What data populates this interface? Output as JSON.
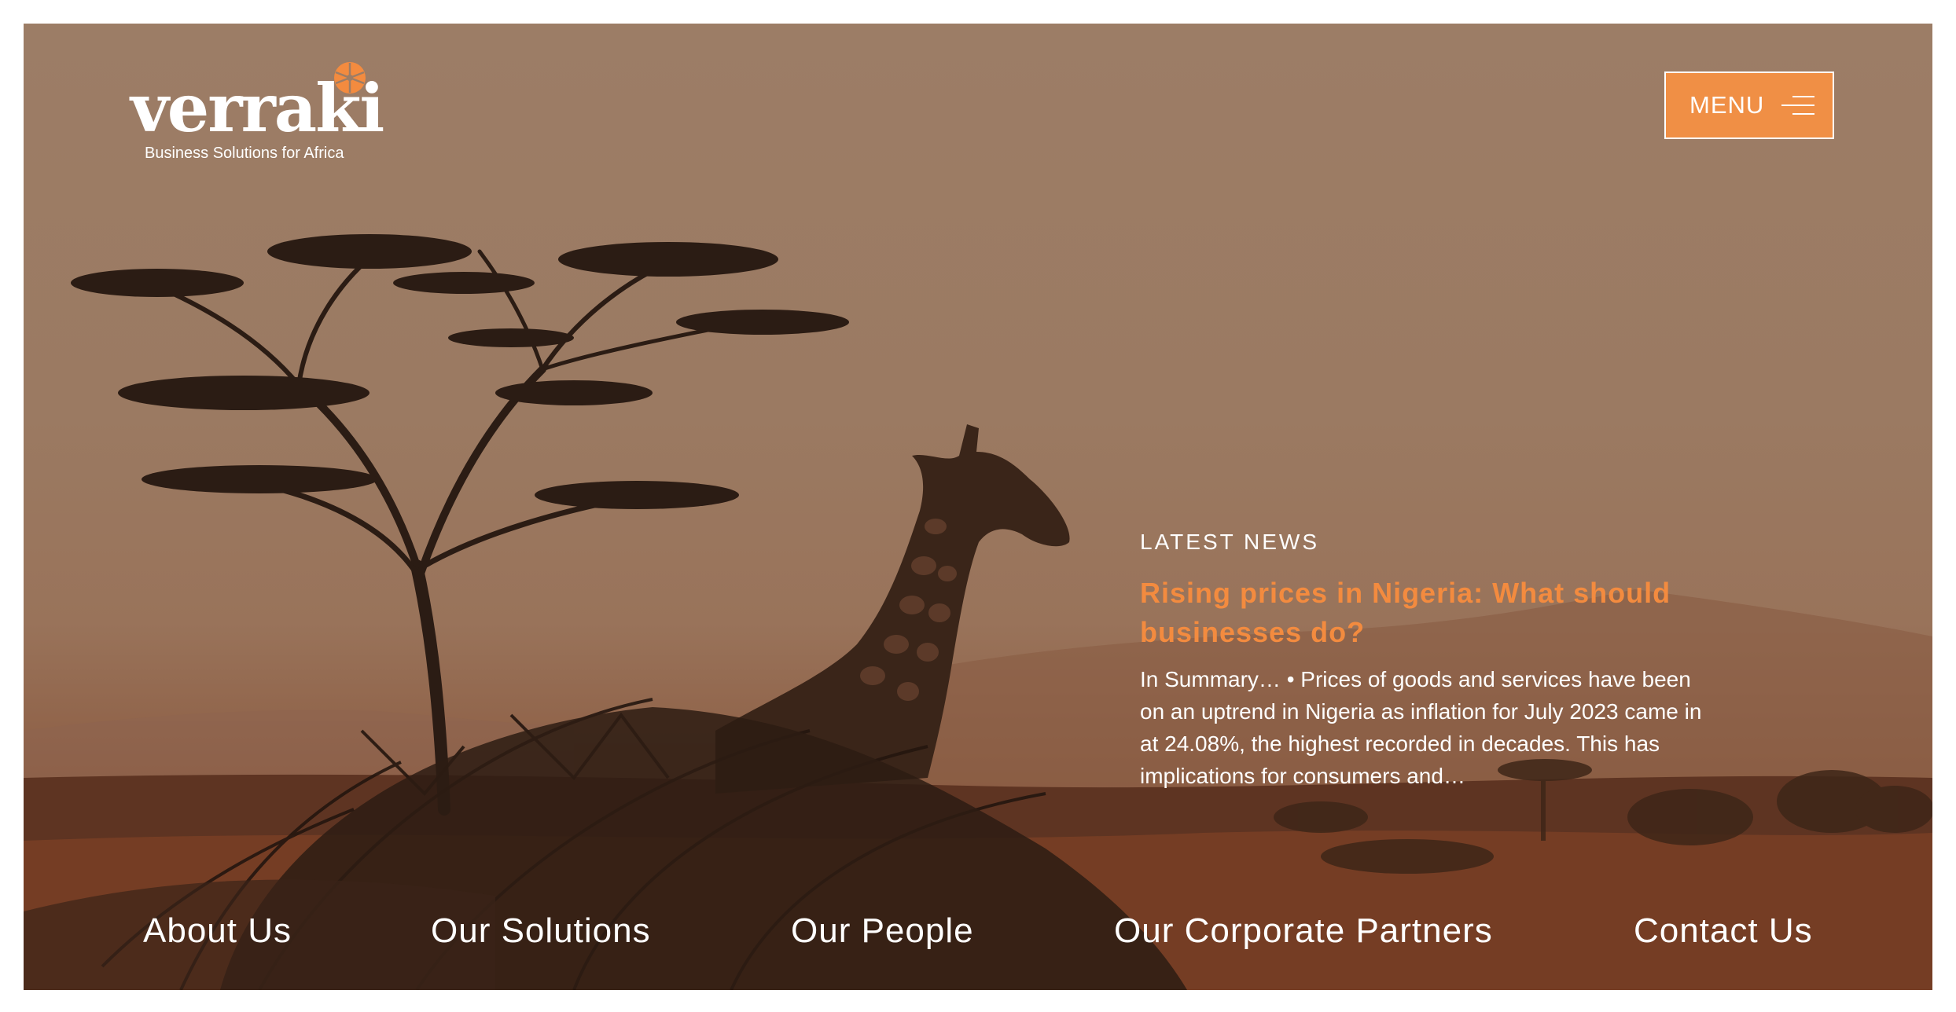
{
  "brand": {
    "logo_text": "verraki",
    "tagline": "Business Solutions for Africa",
    "accent_color": "#f38b3f",
    "logo_mark_icon": "orange-flower-mark"
  },
  "header": {
    "menu_label": "MENU",
    "menu_icon": "hamburger-icon"
  },
  "hero": {
    "background_icon": "giraffe-savanna-photo"
  },
  "news": {
    "kicker": "LATEST NEWS",
    "title": "Rising prices in Nigeria: What should businesses do?",
    "summary": "In Summary… • Prices of goods and services have been on an uptrend in Nigeria as inflation for July 2023 came in at 24.08%, the highest recorded in decades. This has implications for consumers and…"
  },
  "footer_nav": {
    "items": [
      {
        "label": "About Us"
      },
      {
        "label": "Our Solutions"
      },
      {
        "label": "Our People"
      },
      {
        "label": "Our Corporate Partners"
      },
      {
        "label": "Contact Us"
      }
    ]
  }
}
